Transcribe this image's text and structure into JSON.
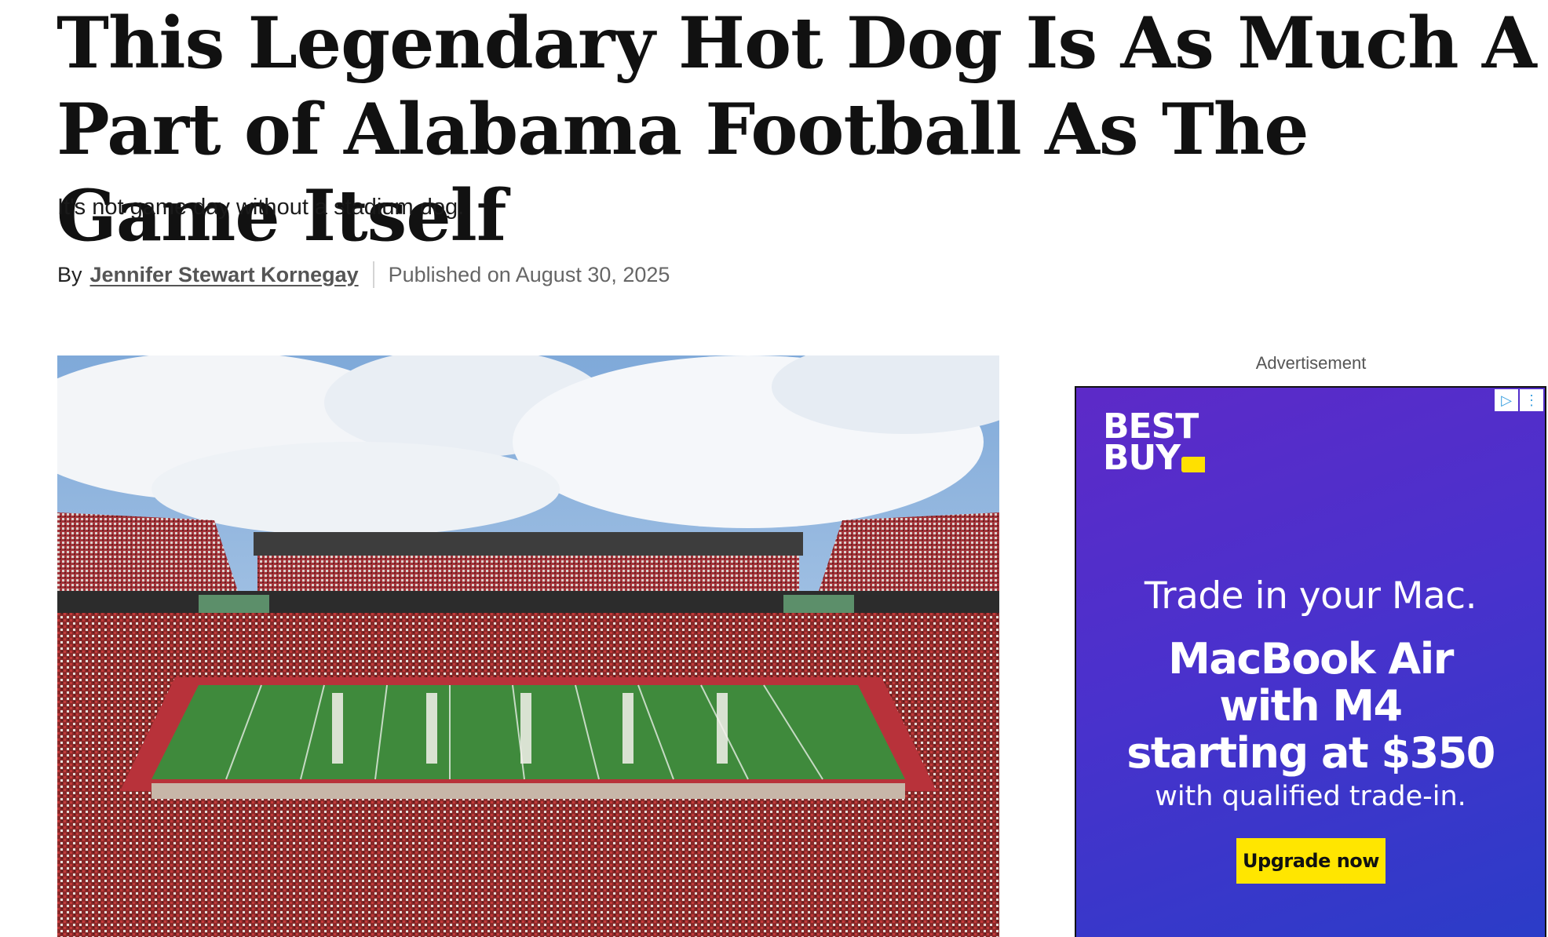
{
  "article": {
    "headline": "This Legendary Hot Dog Is As Much A Part of Alabama Football As The Game Itself",
    "subheadline": "It's not game day without a stadium dog.",
    "byline_prefix": "By",
    "author": "Jennifer Stewart Kornegay",
    "published": "Published on August 30, 2025"
  },
  "hero_image": {
    "description_icon": "stadium-photo"
  },
  "ad": {
    "label": "Advertisement",
    "brand_line1": "BEST",
    "brand_line2": "BUY",
    "headline": "Trade in your Mac.",
    "offer_line1": "MacBook Air",
    "offer_line2": "with M4",
    "offer_line3": "starting at $350",
    "fine_print": "with qualified trade-in.",
    "cta": "Upgrade now",
    "adchoices_icon": "play-triangle-icon",
    "menu_icon": "kebab-menu-icon",
    "colors": {
      "background_start": "#5d2ac8",
      "background_end": "#2b3cc8",
      "cta": "#ffe600",
      "brand_tag": "#ffe000"
    }
  }
}
